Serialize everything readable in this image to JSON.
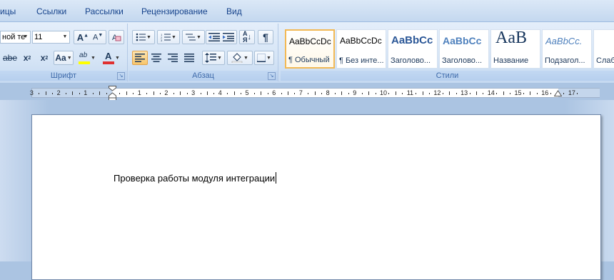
{
  "tabs": [
    "ицы",
    "Ссылки",
    "Рассылки",
    "Рецензирование",
    "Вид"
  ],
  "font_group": {
    "label": "Шрифт",
    "font_name": "ной те",
    "font_size": "11",
    "grow_label": "A",
    "shrink_label": "A",
    "strike_label": "abe",
    "subscript_label": "x",
    "superscript_label": "x",
    "case_label": "Aa",
    "highlight_label": "ab",
    "font_color_label": "A",
    "highlight_color": "#ffff00",
    "font_color": "#e03030"
  },
  "paragraph_group": {
    "label": "Абзац",
    "sort_label": "A",
    "pilcrow": "¶"
  },
  "styles_group": {
    "label": "Стили",
    "items": [
      {
        "sample": "AaBbCcDc",
        "name": "¶ Обычный"
      },
      {
        "sample": "AaBbCcDc",
        "name": "¶ Без инте..."
      },
      {
        "sample": "AaBbCc",
        "name": "Заголово..."
      },
      {
        "sample": "AaBbCc",
        "name": "Заголово..."
      },
      {
        "sample": "AaB",
        "name": "Название"
      },
      {
        "sample": "AaBbCc.",
        "name": "Подзагол..."
      },
      {
        "sample": "",
        "name": "Слаб"
      }
    ]
  },
  "ruler": {
    "labels": [
      "3",
      "2",
      "1",
      "1",
      "2",
      "3",
      "4",
      "5",
      "6",
      "7",
      "8",
      "9",
      "10",
      "11",
      "12",
      "13",
      "14",
      "15",
      "16",
      "17"
    ]
  },
  "document": {
    "text": "Проверка работы модуля интеграции"
  },
  "colors": {
    "accent": "#15428b",
    "selected_style_border": "#f2b955"
  }
}
